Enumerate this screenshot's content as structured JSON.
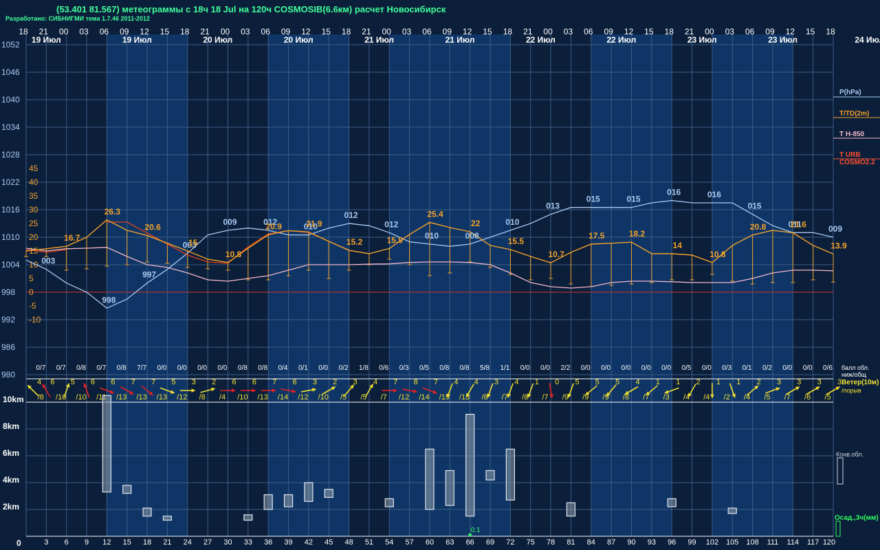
{
  "header": {
    "title": "(53.401 81.567) метеограммы с  18ч 18 Jul на 120ч COSMOSIB(6.6км) расчет Новосибирск",
    "credit": "Разработано: СИБНИГМИ тема 1.7.46 2011-2012"
  },
  "colors": {
    "bg": "#0b1e3a",
    "band": "#0f3566",
    "grid": "#3c5e86",
    "pressure": "#a9c9f0",
    "temp": "#f2a22a",
    "t850": "#f2b8c8",
    "turb": "#e0401a",
    "zero": "#b03030",
    "wind_warm": "#f2e030",
    "wind_cold": "#e82020",
    "text_white": "#ffffff",
    "text_cyan": "#a9c9f0",
    "text_orange": "#f2a22a",
    "text_green": "#30ff60"
  },
  "time_axis": {
    "hour_labels": [
      "18",
      "21",
      "00",
      "03",
      "06",
      "09",
      "12",
      "15",
      "18",
      "21",
      "00",
      "03",
      "06",
      "09",
      "12",
      "15",
      "18",
      "21",
      "00",
      "03",
      "06",
      "09",
      "12",
      "15",
      "18",
      "21",
      "00",
      "03",
      "06",
      "09",
      "12",
      "15",
      "18",
      "21",
      "00",
      "03",
      "06",
      "09",
      "12",
      "15",
      "18"
    ],
    "day_labels": [
      {
        "text": "19 Июл",
        "col": 1
      },
      {
        "text": "19 Июл",
        "col": 5.5
      },
      {
        "text": "20 Июл",
        "col": 9.5
      },
      {
        "text": "20 Июл",
        "col": 13.5
      },
      {
        "text": "21 Июл",
        "col": 17.5
      },
      {
        "text": "21 Июл",
        "col": 21.5
      },
      {
        "text": "22 Июл",
        "col": 25.5
      },
      {
        "text": "22 Июл",
        "col": 29.5
      },
      {
        "text": "23 Июл",
        "col": 33.5
      },
      {
        "text": "23 Июл",
        "col": 37.5
      },
      {
        "text": "24 Июл",
        "col": 41.9
      }
    ],
    "forecast_hours": [
      "0",
      "3",
      "6",
      "9",
      "12",
      "15",
      "18",
      "21",
      "24",
      "27",
      "30",
      "33",
      "36",
      "39",
      "42",
      "45",
      "48",
      "51",
      "54",
      "57",
      "60",
      "63",
      "66",
      "69",
      "72",
      "75",
      "78",
      "81",
      "84",
      "87",
      "90",
      "93",
      "96",
      "99",
      "102",
      "105",
      "108",
      "111",
      "114",
      "117",
      "120"
    ]
  },
  "left_axis": {
    "pressure_ticks": [
      "1052",
      "1046",
      "1040",
      "1034",
      "1028",
      "1022",
      "1016",
      "1010",
      "1004",
      "998",
      "992",
      "986",
      "980"
    ],
    "temp_ticks": [
      "45",
      "40",
      "35",
      "30",
      "25",
      "20",
      "15",
      "10",
      "5",
      "0",
      "-5",
      "-10"
    ],
    "height_ticks": [
      "10km",
      "8km",
      "6km",
      "4km",
      "2km",
      "0"
    ]
  },
  "legend": {
    "pressure": "P(hPa)",
    "temp": "T/TD(2m)",
    "t850": "T H-850",
    "turb1": "T URB",
    "turb2": "COSMO2.2",
    "clouds": [
      "балл обл.",
      "ниж/общ"
    ],
    "wind": [
      "Ветер(10м)",
      "/порыв"
    ],
    "conv": "Конв.обл.",
    "precip": "Осад.,3ч(мм)"
  },
  "chart_data": {
    "type": "line",
    "x_hours": [
      0,
      3,
      6,
      9,
      12,
      15,
      18,
      21,
      24,
      27,
      30,
      33,
      36,
      39,
      42,
      45,
      48,
      51,
      54,
      57,
      60,
      63,
      66,
      69,
      72,
      75,
      78,
      81,
      84,
      87,
      90,
      93,
      96,
      99,
      102,
      105,
      108,
      111,
      114,
      117,
      120
    ],
    "ylim_pressure": [
      980,
      1052
    ],
    "ylim_temp": [
      -11.5,
      47.5
    ],
    "series": [
      {
        "name": "P(hPa)",
        "key": "pressure",
        "values": [
          1005,
          1003,
          1000,
          998,
          994.5,
          996.5,
          1000,
          1003,
          1006.5,
          1010.5,
          1011.5,
          1012,
          1011.5,
          1010.5,
          1010.5,
          1012,
          1013,
          1012.5,
          1011,
          1009,
          1008.5,
          1008,
          1008.5,
          1010,
          1011.5,
          1013,
          1015,
          1016.5,
          1016.5,
          1016.5,
          1016.5,
          1017.5,
          1018,
          1017.5,
          1017.5,
          1017.5,
          1015,
          1012.5,
          1011,
          1011,
          1010
        ],
        "labels": [
          {
            "i": 1,
            "t": "003"
          },
          {
            "i": 4,
            "t": "998"
          },
          {
            "i": 6,
            "t": "997"
          },
          {
            "i": 8,
            "t": "003"
          },
          {
            "i": 10,
            "t": "009"
          },
          {
            "i": 12,
            "t": "012"
          },
          {
            "i": 14,
            "t": "010"
          },
          {
            "i": 16,
            "t": "012"
          },
          {
            "i": 18,
            "t": "012"
          },
          {
            "i": 20,
            "t": "010"
          },
          {
            "i": 22,
            "t": "008"
          },
          {
            "i": 24,
            "t": "010"
          },
          {
            "i": 26,
            "t": "013"
          },
          {
            "i": 28,
            "t": "015"
          },
          {
            "i": 30,
            "t": "015"
          },
          {
            "i": 32,
            "t": "016"
          },
          {
            "i": 34,
            "t": "016"
          },
          {
            "i": 36,
            "t": "015"
          },
          {
            "i": 38,
            "t": "011"
          },
          {
            "i": 40,
            "t": "009"
          }
        ]
      },
      {
        "name": "T/TD(2m)",
        "key": "temp",
        "values": [
          15,
          15.8,
          16.7,
          20,
          26.3,
          22.5,
          20.6,
          17.8,
          15,
          12,
          10.8,
          16,
          20.9,
          22.4,
          21.9,
          18.5,
          15.2,
          14,
          15.9,
          21,
          25.4,
          23.5,
          22,
          17,
          15.5,
          13,
          10.7,
          14.5,
          17.5,
          17.8,
          18.2,
          14,
          14,
          13.5,
          10.8,
          17,
          20.8,
          22.5,
          21.6,
          17,
          13.9
        ],
        "dew": [
          13,
          13,
          8,
          8.5,
          9.5,
          10,
          11,
          10.5,
          9,
          8.5,
          8,
          4.5,
          4.5,
          6,
          8,
          5,
          8,
          10,
          12,
          10,
          6,
          7,
          11,
          9,
          6.5,
          4.5,
          5,
          3,
          2,
          2.5,
          3,
          3.5,
          4.5,
          4.5,
          6.5,
          4,
          3,
          3.5,
          3.5,
          4.5,
          3.7
        ],
        "labels": [
          {
            "i": 2,
            "t": "16.7"
          },
          {
            "i": 4,
            "t": "26.3"
          },
          {
            "i": 6,
            "t": "20.6"
          },
          {
            "i": 8,
            "t": "15"
          },
          {
            "i": 10,
            "t": "10.8"
          },
          {
            "i": 12,
            "t": "20.9"
          },
          {
            "i": 14,
            "t": "21.9"
          },
          {
            "i": 16,
            "t": "15.2"
          },
          {
            "i": 18,
            "t": "15.9"
          },
          {
            "i": 20,
            "t": "25.4"
          },
          {
            "i": 22,
            "t": "22"
          },
          {
            "i": 24,
            "t": "15.5"
          },
          {
            "i": 26,
            "t": "10.7"
          },
          {
            "i": 28,
            "t": "17.5"
          },
          {
            "i": 30,
            "t": "18.2"
          },
          {
            "i": 32,
            "t": "14"
          },
          {
            "i": 34,
            "t": "10.8"
          },
          {
            "i": 36,
            "t": "20.8"
          },
          {
            "i": 38,
            "t": "21.6"
          },
          {
            "i": 40,
            "t": "13.9"
          }
        ]
      },
      {
        "name": "T H-850",
        "key": "t850",
        "values": [
          16,
          15,
          15.8,
          16,
          16.3,
          13,
          10,
          9,
          7,
          4.5,
          4,
          5,
          6,
          8,
          10,
          10,
          10,
          10.2,
          10.3,
          10.8,
          11,
          11,
          10.8,
          10,
          7,
          3.5,
          2,
          1.5,
          2,
          3.5,
          4,
          4,
          3.8,
          3.5,
          3.5,
          3.5,
          5,
          7,
          8,
          8,
          7.8
        ]
      },
      {
        "name": "T URB COSMO2.2",
        "key": "turb",
        "values": [
          15.5,
          14.5,
          15.5,
          null,
          25.5,
          25.5,
          21.5,
          17.5,
          13.5,
          11,
          10.5,
          16.5,
          21.2,
          22.4,
          21.7,
          18.5,
          15.3,
          null,
          null,
          null,
          null,
          null,
          null,
          null,
          null,
          null,
          null,
          null,
          null,
          null,
          null,
          null,
          null,
          null,
          null,
          null,
          null,
          null,
          null,
          null,
          null
        ]
      }
    ],
    "cloud_cover": [
      "0/7",
      "0/7",
      "0/8",
      "0/7",
      "0/8",
      "7/7",
      "0/0",
      "0/0",
      "0/0",
      "0/0",
      "0/8",
      "0/8",
      "0/4",
      "0/1",
      "0/0",
      "0/2",
      "1/8",
      "0/6",
      "0/3",
      "0/5",
      "0/8",
      "0/8",
      "5/8",
      "1/1",
      "0/0",
      "0/0",
      "2/2",
      "0/0",
      "0/0",
      "0/0",
      "0/0",
      "0/0",
      "0/5",
      "0/0",
      "0/3",
      "0/1",
      "0/2",
      "0/0",
      "0/0",
      "0/6"
    ],
    "wind_speed": [
      "4",
      "6",
      "5",
      "6",
      "6",
      "7",
      "7",
      "5",
      "3",
      "2",
      "6",
      "6",
      "7",
      "6",
      "3",
      "2",
      "3",
      "4",
      "7",
      "8",
      "7",
      "4",
      "4",
      "3",
      "4",
      "1",
      "0",
      "5",
      "5",
      "5",
      "4",
      "1",
      "1",
      "2",
      "1",
      "1",
      "2",
      "3",
      "3",
      "3",
      "3"
    ],
    "wind_gust": [
      "/8",
      "/10",
      "/10",
      "/11",
      "/13",
      "/13",
      "/13",
      "/12",
      "/8",
      "/4",
      "/10",
      "/13",
      "/14",
      "/12",
      "/10",
      "/5",
      "/5",
      "/7",
      "/12",
      "/14",
      "/15",
      "/13",
      "/8",
      "/7",
      "/8",
      "/7",
      "/9",
      "/9",
      "/9",
      "/8",
      "/7",
      "/3",
      "/4",
      "/4",
      "/2",
      "/4",
      "/5",
      "/7",
      "/6",
      "/5"
    ],
    "wind_dir_deg": [
      315,
      330,
      20,
      340,
      110,
      120,
      130,
      110,
      90,
      75,
      90,
      90,
      90,
      100,
      80,
      60,
      40,
      30,
      90,
      100,
      110,
      200,
      210,
      200,
      200,
      200,
      170,
      200,
      230,
      220,
      240,
      230,
      250,
      210,
      180,
      160,
      50,
      70,
      60,
      60,
      60
    ],
    "wind_cold": [
      false,
      true,
      false,
      true,
      true,
      true,
      true,
      false,
      false,
      false,
      true,
      true,
      true,
      true,
      false,
      false,
      false,
      false,
      true,
      true,
      true,
      false,
      false,
      false,
      false,
      false,
      true,
      false,
      false,
      false,
      false,
      false,
      false,
      false,
      false,
      false,
      false,
      false,
      false,
      false,
      false
    ],
    "conv_clouds_km": [
      {
        "h": 12,
        "bot": 3.3,
        "top": 10.5
      },
      {
        "h": 15,
        "bot": 3.2,
        "top": 3.8
      },
      {
        "h": 18,
        "bot": 1.5,
        "top": 2.1
      },
      {
        "h": 21,
        "bot": 1.2,
        "top": 1.5
      },
      {
        "h": 33,
        "bot": 1.2,
        "top": 1.6
      },
      {
        "h": 36,
        "bot": 2.0,
        "top": 3.1
      },
      {
        "h": 39,
        "bot": 2.2,
        "top": 3.1
      },
      {
        "h": 42,
        "bot": 2.6,
        "top": 4.0
      },
      {
        "h": 45,
        "bot": 2.9,
        "top": 3.5
      },
      {
        "h": 54,
        "bot": 2.2,
        "top": 2.8
      },
      {
        "h": 60,
        "bot": 2.0,
        "top": 6.5
      },
      {
        "h": 63,
        "bot": 2.3,
        "top": 4.9
      },
      {
        "h": 66,
        "bot": 1.5,
        "top": 9.1
      },
      {
        "h": 69,
        "bot": 4.2,
        "top": 4.9
      },
      {
        "h": 72,
        "bot": 2.7,
        "top": 6.5
      },
      {
        "h": 81,
        "bot": 1.5,
        "top": 2.5
      },
      {
        "h": 96,
        "bot": 2.2,
        "top": 2.8
      },
      {
        "h": 105,
        "bot": 1.7,
        "top": 2.1
      }
    ],
    "precip": [
      {
        "h": 66,
        "label": "0.1"
      }
    ]
  }
}
